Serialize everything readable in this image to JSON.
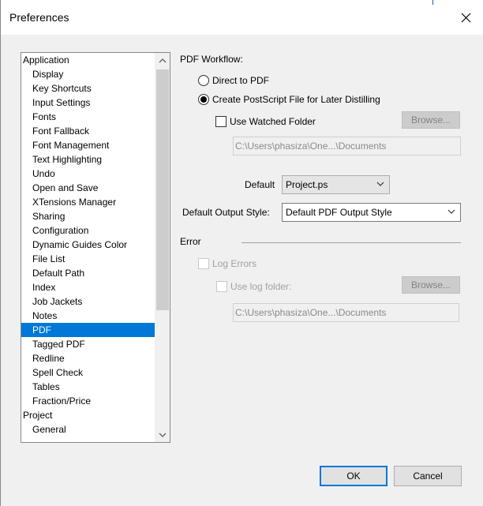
{
  "window": {
    "title": "Preferences"
  },
  "tree": {
    "items": [
      {
        "label": "Application",
        "level": 0
      },
      {
        "label": "Display",
        "level": 1
      },
      {
        "label": "Key Shortcuts",
        "level": 1
      },
      {
        "label": "Input Settings",
        "level": 1
      },
      {
        "label": "Fonts",
        "level": 1
      },
      {
        "label": "Font Fallback",
        "level": 1
      },
      {
        "label": "Font Management",
        "level": 1
      },
      {
        "label": "Text Highlighting",
        "level": 1
      },
      {
        "label": "Undo",
        "level": 1
      },
      {
        "label": "Open and Save",
        "level": 1
      },
      {
        "label": "XTensions Manager",
        "level": 1
      },
      {
        "label": "Sharing",
        "level": 1
      },
      {
        "label": "Configuration",
        "level": 1
      },
      {
        "label": "Dynamic Guides Color",
        "level": 1
      },
      {
        "label": "File List",
        "level": 1
      },
      {
        "label": "Default Path",
        "level": 1
      },
      {
        "label": "Index",
        "level": 1
      },
      {
        "label": "Job Jackets",
        "level": 1
      },
      {
        "label": "Notes",
        "level": 1
      },
      {
        "label": "PDF",
        "level": 1,
        "selected": true
      },
      {
        "label": "Tagged PDF",
        "level": 1
      },
      {
        "label": "Redline",
        "level": 1
      },
      {
        "label": "Spell Check",
        "level": 1
      },
      {
        "label": "Tables",
        "level": 1
      },
      {
        "label": "Fraction/Price",
        "level": 1
      },
      {
        "label": "Project",
        "level": 0
      },
      {
        "label": "General",
        "level": 1
      }
    ]
  },
  "pdf": {
    "workflow_label": "PDF Workflow:",
    "direct_label": "Direct to PDF",
    "postscript_label": "Create PostScript File for Later Distilling",
    "watched_label": "Use Watched Folder",
    "browse_label": "Browse...",
    "watched_path": "C:\\Users\\phasiza\\One...\\Documents",
    "default_label": "Default",
    "default_value": "Project.ps",
    "output_style_label": "Default Output Style:",
    "output_style_value": "Default PDF Output Style",
    "error_label": "Error",
    "log_errors_label": "Log Errors",
    "log_folder_label": "Use log folder:",
    "log_browse_label": "Browse...",
    "log_path": "C:\\Users\\phasiza\\One...\\Documents"
  },
  "footer": {
    "ok_label": "OK",
    "cancel_label": "Cancel"
  }
}
